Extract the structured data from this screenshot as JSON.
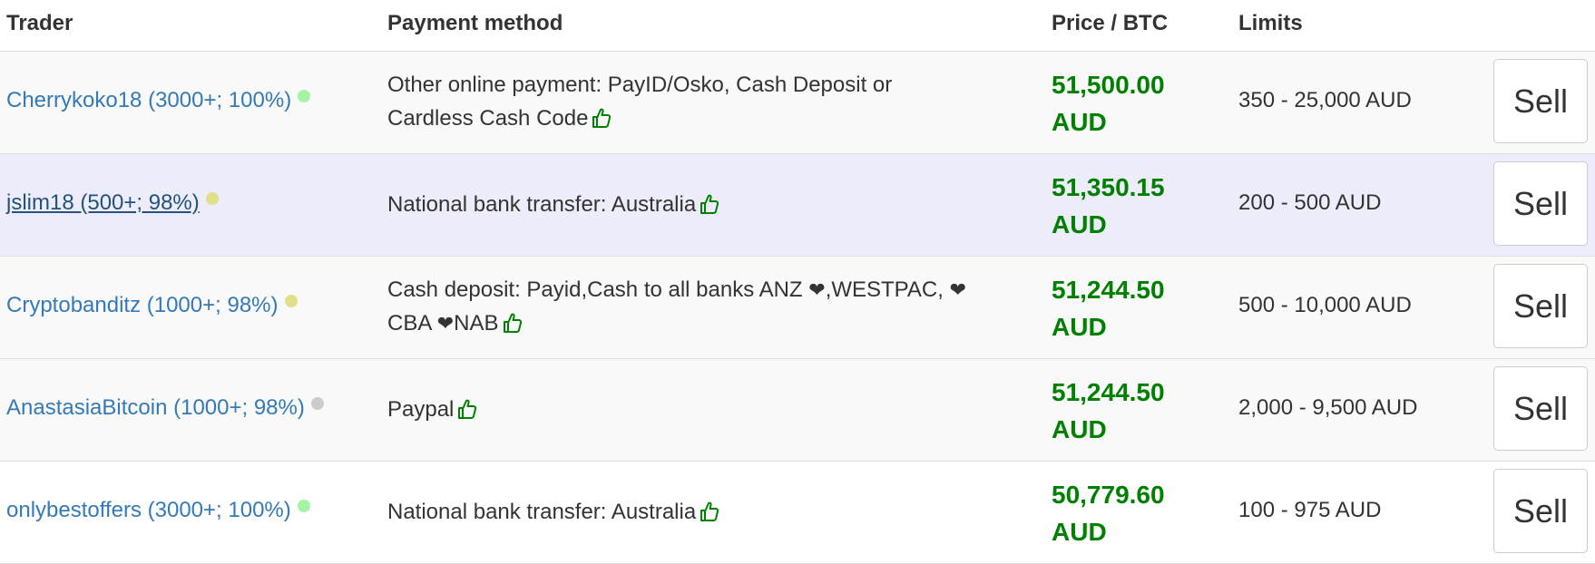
{
  "headers": {
    "trader": "Trader",
    "payment": "Payment method",
    "price": "Price / BTC",
    "limits": "Limits"
  },
  "colors": {
    "link": "#337ab7",
    "price": "#008000",
    "online_dot": "#a3f5a3",
    "away_dot": "#e0e08a",
    "offline_dot": "#cccccc",
    "hover_row": "#ececfb"
  },
  "rows": [
    {
      "trader": "Cherrykoko18 (3000+; 100%)",
      "status": "online",
      "payment_line1": "Other online payment: PayID/Osko, Cash Deposit or",
      "payment_line2": "Cardless Cash Code",
      "price_amount": "51,500.00",
      "price_currency": "AUD",
      "limits": "350 - 25,000 AUD",
      "sell_label": "Sell"
    },
    {
      "trader": "jslim18 (500+; 98%)",
      "status": "away",
      "payment": "National bank transfer: Australia",
      "price_amount": "51,350.15",
      "price_currency": "AUD",
      "limits": "200 - 500 AUD",
      "sell_label": "Sell"
    },
    {
      "trader": "Cryptobanditz (1000+; 98%)",
      "status": "away",
      "payment_a": "Cash deposit: Payid,Cash to all banks ANZ ",
      "payment_b": ",WESTPAC, ",
      "payment_c": "CBA ",
      "payment_d": "NAB",
      "price_amount": "51,244.50",
      "price_currency": "AUD",
      "limits": "500 - 10,000 AUD",
      "sell_label": "Sell"
    },
    {
      "trader": "AnastasiaBitcoin (1000+; 98%)",
      "status": "offline",
      "payment": "Paypal",
      "price_amount": "51,244.50",
      "price_currency": "AUD",
      "limits": "2,000 - 9,500 AUD",
      "sell_label": "Sell"
    },
    {
      "trader": "onlybestoffers (3000+; 100%)",
      "status": "online",
      "payment": "National bank transfer: Australia",
      "price_amount": "50,779.60",
      "price_currency": "AUD",
      "limits": "100 - 975 AUD",
      "sell_label": "Sell"
    }
  ]
}
